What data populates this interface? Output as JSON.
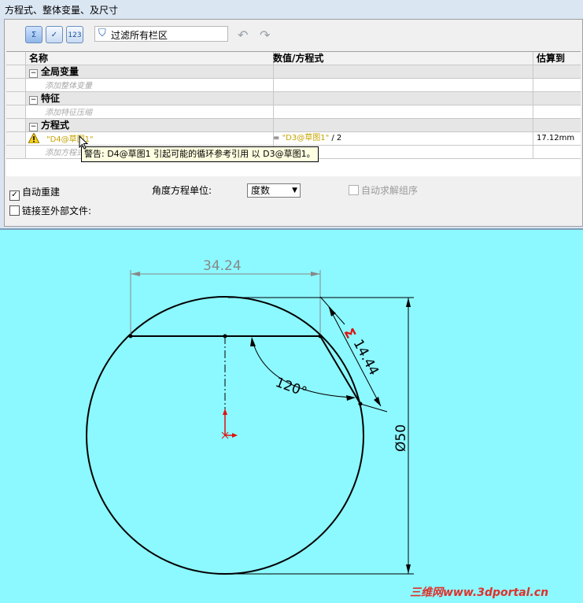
{
  "window": {
    "title": "方程式、整体变量、及尺寸"
  },
  "toolbar": {
    "equation_view_btn": "Σ",
    "sketch_view_btn": "✓",
    "ordered_view_btn": "123",
    "filter_placeholder": "过滤所有栏区",
    "undo_icon": "undo-icon",
    "redo_icon": "redo-icon"
  },
  "table": {
    "headers": {
      "name": "名称",
      "value": "数值/方程式",
      "estimate": "估算到"
    },
    "groups": [
      {
        "label": "全局变量",
        "add_text": "添加整体变量"
      },
      {
        "label": "特征",
        "add_text": "添加特征压缩"
      },
      {
        "label": "方程式",
        "add_text": "添加方程式"
      }
    ],
    "equation": {
      "name": "\"D4@草图1\"",
      "equals": "= ",
      "ref": "\"D3@草图1\"",
      "rest": " / 2",
      "estimate": "17.12mm"
    },
    "tooltip": "警告: D4@草图1 引起可能的循环参考引用 以 D3@草图1。"
  },
  "options": {
    "auto_rebuild": {
      "label": "自动重建",
      "checked": true
    },
    "link_external": {
      "label": "链接至外部文件:",
      "checked": false
    },
    "angle_unit_label": "角度方程单位:",
    "angle_unit_value": "度数",
    "auto_solve": {
      "label": "自动求解组序",
      "checked": false
    }
  },
  "sketch": {
    "dim_width": "34.24",
    "dim_chord": "14.44",
    "dim_chord_marker": "Σ",
    "dim_angle": "120°",
    "dim_diameter": "Ø50"
  },
  "watermark": "三维网www.3dportal.cn"
}
